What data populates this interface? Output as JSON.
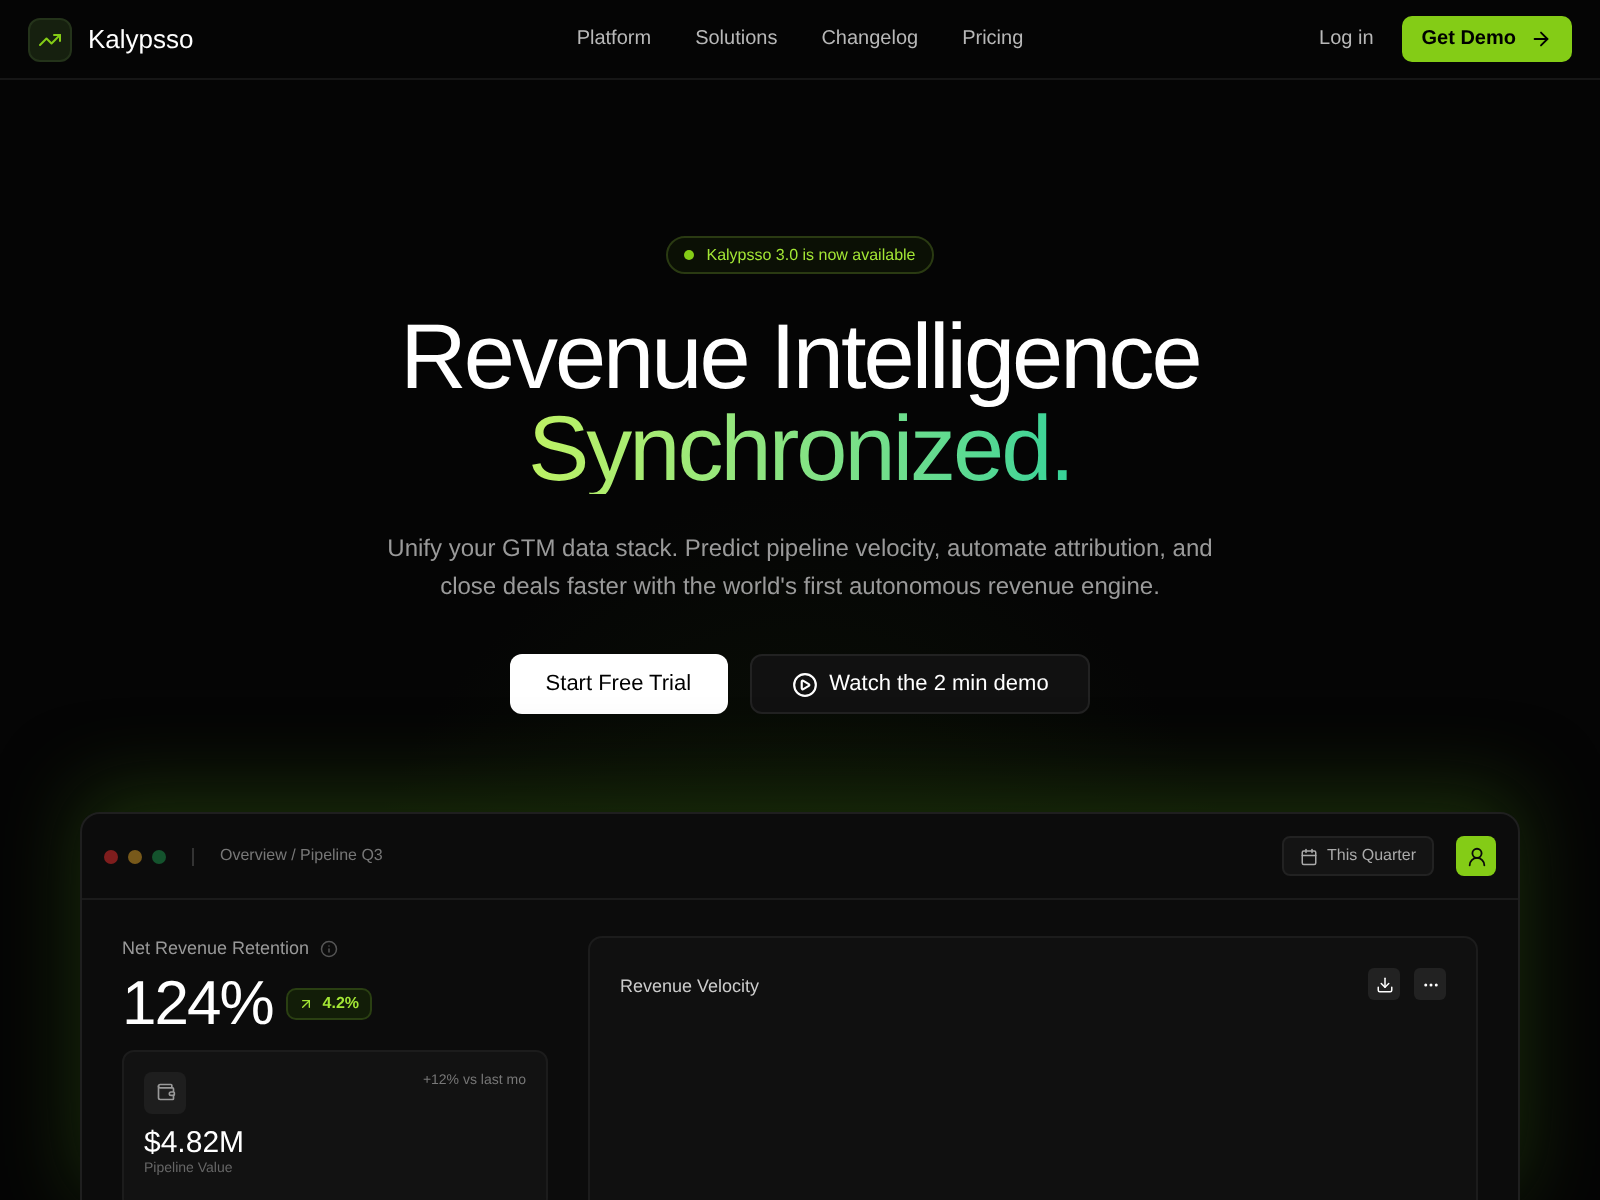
{
  "brand": {
    "name": "Kalypsso"
  },
  "nav": {
    "links": [
      "Platform",
      "Solutions",
      "Changelog",
      "Pricing"
    ],
    "login": "Log in",
    "cta": "Get Demo"
  },
  "hero": {
    "badge": "Kalypsso 3.0 is now available",
    "title_line_1": "Revenue Intelligence",
    "title_line_2": "Synchronized.",
    "description": "Unify your GTM data stack. Predict pipeline velocity, automate attribution, and close deals faster with the world's first autonomous revenue engine.",
    "primary_button": "Start Free Trial",
    "secondary_button": "Watch the 2 min demo"
  },
  "dashboard": {
    "breadcrumb": "Overview / Pipeline Q3",
    "period": "This Quarter",
    "metric": {
      "label": "Net Revenue Retention",
      "value": "124%",
      "change": "4.2%"
    },
    "card": {
      "change": "+12% vs last mo",
      "value": "$4.82M",
      "label": "Pipeline Value"
    },
    "chart_panel": {
      "title": "Revenue Velocity"
    }
  }
}
